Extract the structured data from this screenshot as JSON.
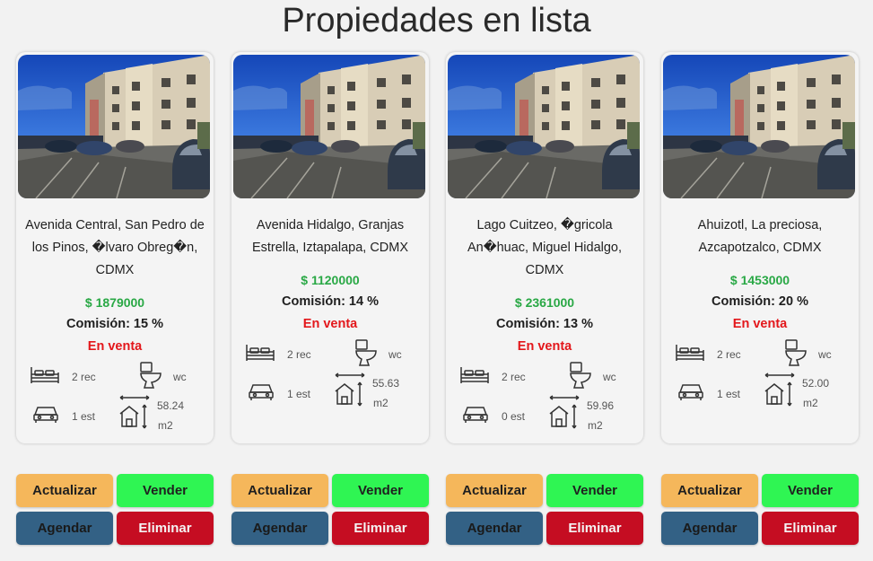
{
  "page": {
    "title": "Propiedades en lista"
  },
  "labels": {
    "bedrooms_unit": "rec",
    "bathroom_label": "wc",
    "parking_unit": "est",
    "area_unit": "m2"
  },
  "colors": {
    "price": "#29a845",
    "status": "#e3171b",
    "btn_update": "#f5b75b",
    "btn_sell": "#2ff553",
    "btn_schedule": "#336185",
    "btn_delete": "#c50d22"
  },
  "buttons": {
    "update": "Actualizar",
    "sell": "Vender",
    "schedule": "Agendar",
    "delete": "Eliminar"
  },
  "properties": [
    {
      "address": "Avenida Central, San Pedro de los Pinos, �lvaro Obreg�n, CDMX",
      "price": "$ 1879000",
      "commission": "Comisión: 15 %",
      "status": "En venta",
      "bedrooms": "2 rec",
      "bathroom": "wc",
      "parking": "1 est",
      "area": "58.24",
      "area_unit": "m2"
    },
    {
      "address": "Avenida Hidalgo, Granjas Estrella, Iztapalapa, CDMX",
      "price": "$ 1120000",
      "commission": "Comisión: 14 %",
      "status": "En venta",
      "bedrooms": "2 rec",
      "bathroom": "wc",
      "parking": "1 est",
      "area": "55.63",
      "area_unit": "m2"
    },
    {
      "address": "Lago Cuitzeo, �gricola An�huac, Miguel Hidalgo, CDMX",
      "price": "$ 2361000",
      "commission": "Comisión: 13 %",
      "status": "En venta",
      "bedrooms": "2 rec",
      "bathroom": "wc",
      "parking": "0 est",
      "area": "59.96",
      "area_unit": "m2"
    },
    {
      "address": "Ahuizotl, La preciosa, Azcapotzalco, CDMX",
      "price": "$ 1453000",
      "commission": "Comisión: 20 %",
      "status": "En venta",
      "bedrooms": "2 rec",
      "bathroom": "wc",
      "parking": "1 est",
      "area": "52.00",
      "area_unit": "m2"
    }
  ]
}
